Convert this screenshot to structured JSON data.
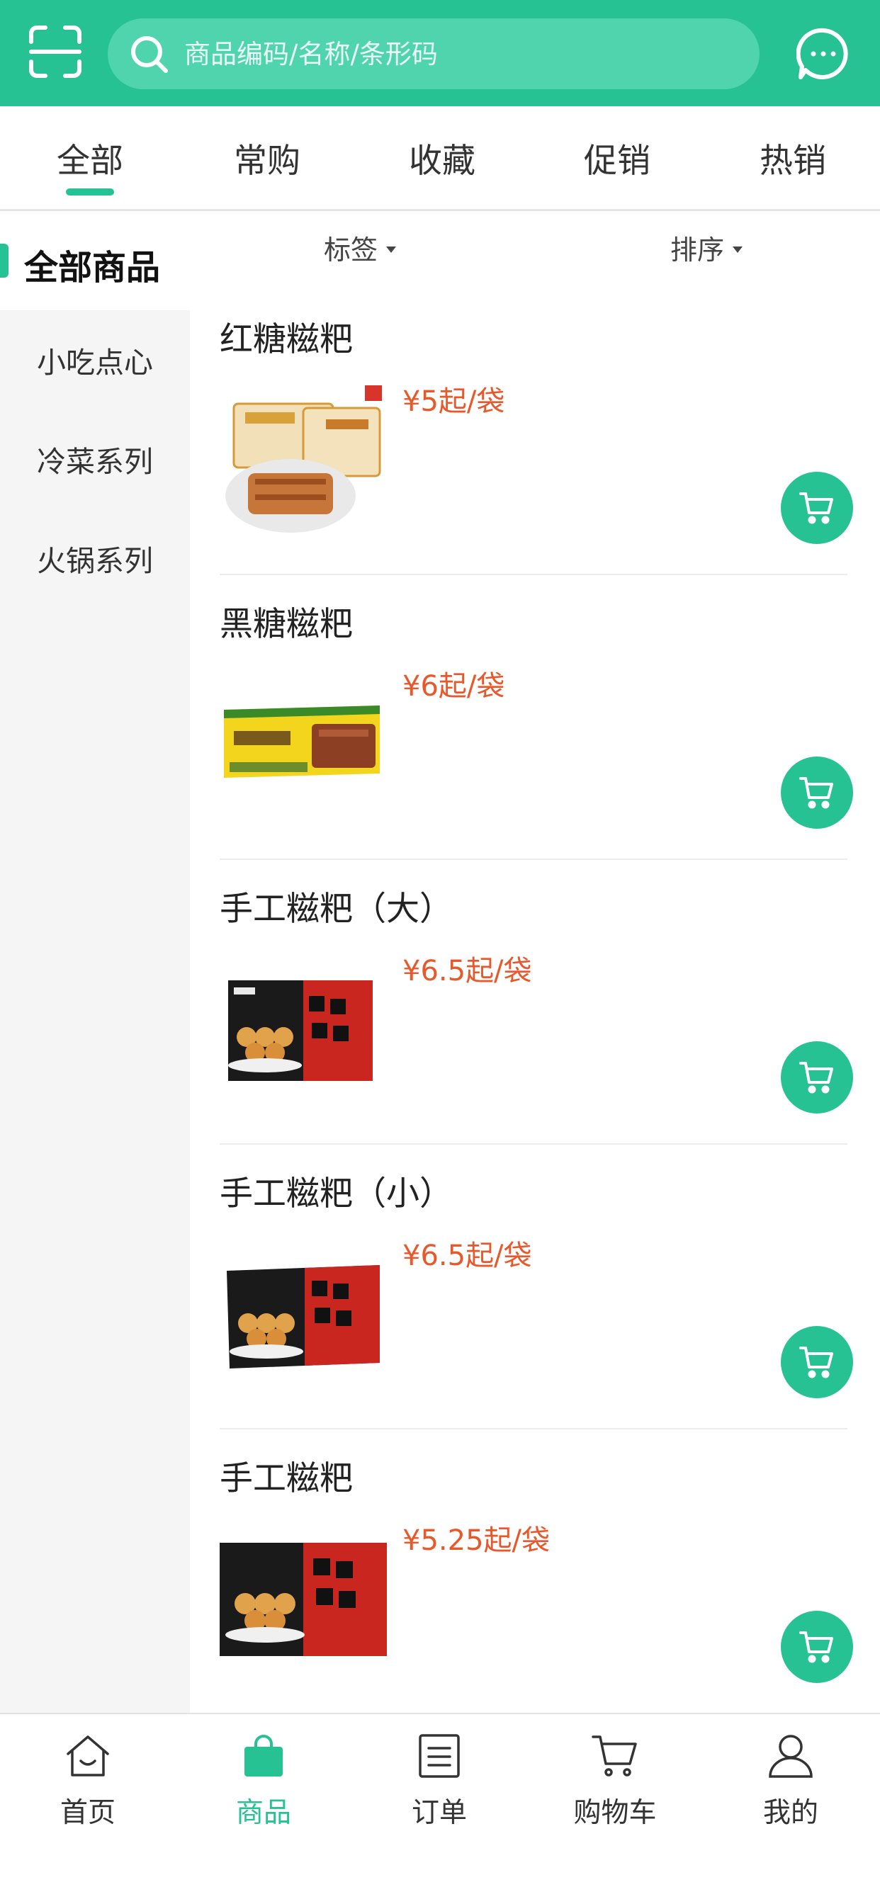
{
  "colors": {
    "brand": "#27c294",
    "search_bg": "#4fd4ad",
    "price": "#e8582b",
    "sidebar_bg": "#f5f5f5"
  },
  "header": {
    "scan_icon": "scan-icon",
    "search": {
      "placeholder": "商品编码/名称/条形码",
      "icon": "search-icon"
    },
    "message_icon": "message-icon"
  },
  "tabs": [
    {
      "label": "全部",
      "active": true
    },
    {
      "label": "常购",
      "active": false
    },
    {
      "label": "收藏",
      "active": false
    },
    {
      "label": "促销",
      "active": false
    },
    {
      "label": "热销",
      "active": false
    }
  ],
  "sidebar": {
    "active_label": "全部商品",
    "items": [
      {
        "label": "小吃点心"
      },
      {
        "label": "冷菜系列"
      },
      {
        "label": "火锅系列"
      }
    ]
  },
  "filters": {
    "tag_label": "标签",
    "sort_label": "排序"
  },
  "products": [
    {
      "name": "红糖糍粑",
      "price": "¥5起/袋",
      "image": "brown-sugar-ciba-photo"
    },
    {
      "name": "黑糖糍粑",
      "price": "¥6起/袋",
      "image": "black-sugar-ciba-photo"
    },
    {
      "name": "手工糍粑（大）",
      "price": "¥6.5起/袋",
      "image": "handmade-ciba-large-photo"
    },
    {
      "name": "手工糍粑（小）",
      "price": "¥6.5起/袋",
      "image": "handmade-ciba-small-photo"
    },
    {
      "name": "手工糍粑",
      "price": "¥5.25起/袋",
      "image": "handmade-ciba-photo"
    }
  ],
  "bottom_nav": [
    {
      "label": "首页",
      "icon": "home-icon",
      "active": false
    },
    {
      "label": "商品",
      "icon": "shopping-bag-icon",
      "active": true
    },
    {
      "label": "订单",
      "icon": "order-list-icon",
      "active": false
    },
    {
      "label": "购物车",
      "icon": "cart-icon",
      "active": false
    },
    {
      "label": "我的",
      "icon": "user-icon",
      "active": false
    }
  ]
}
